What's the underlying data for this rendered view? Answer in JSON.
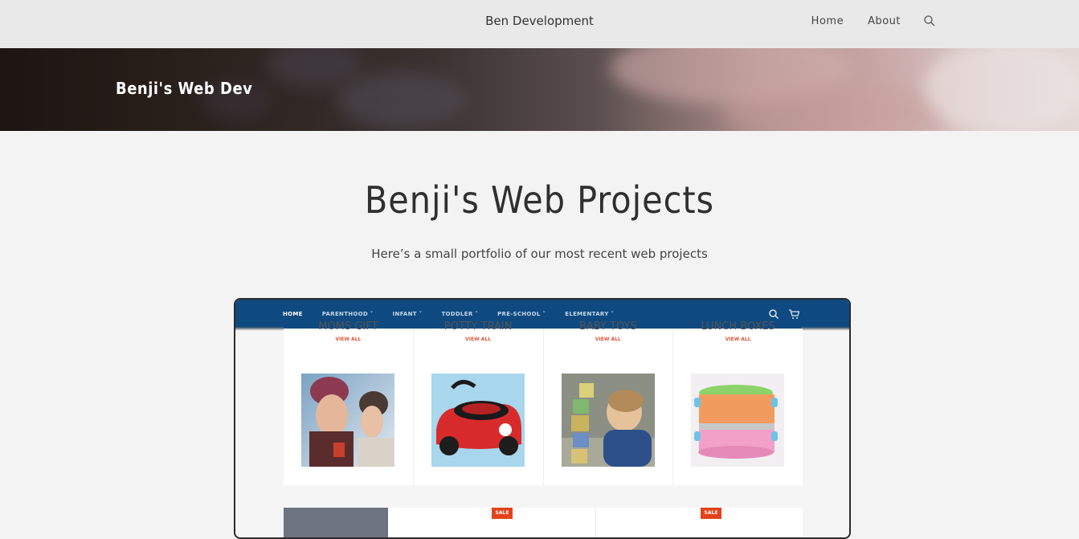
{
  "header": {
    "site_title": "Ben Development",
    "nav": {
      "home": "Home",
      "about": "About"
    },
    "search_icon": "search-icon"
  },
  "hero": {
    "title": "Benji's Web Dev"
  },
  "main": {
    "title": "Benji's Web Projects",
    "subtitle": "Here’s a small portfolio of our most recent web projects"
  },
  "preview": {
    "nav_items": [
      "HOME",
      "PARENTHOOD",
      "INFANT",
      "TODDLER",
      "PRE-SCHOOL",
      "ELEMENTARY"
    ],
    "icons": [
      "search-icon",
      "cart-icon"
    ],
    "cards": [
      {
        "title": "MOMS GIFT",
        "link": "VIEW ALL",
        "image": "mother-daughter-photo"
      },
      {
        "title": "POTTY TRAIN",
        "link": "VIEW ALL",
        "image": "potty-car-photo"
      },
      {
        "title": "BABY TOYS",
        "link": "VIEW ALL",
        "image": "toddler-blocks-photo"
      },
      {
        "title": "LUNCH BOXES",
        "link": "VIEW ALL",
        "image": "lunch-box-photo"
      }
    ],
    "sale_badge": "SALE",
    "colors": {
      "nav": "#0e4a80",
      "accent": "#d9583b",
      "sale": "#e4421a"
    }
  }
}
